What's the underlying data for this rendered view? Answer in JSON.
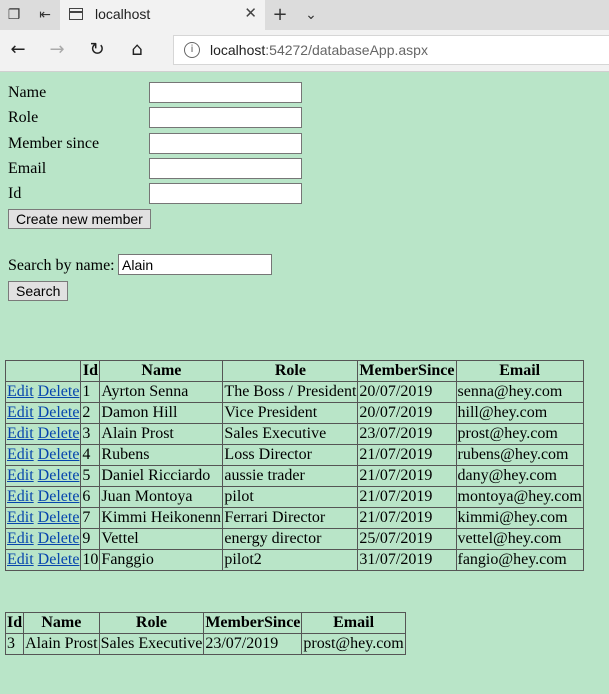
{
  "browser": {
    "tab_title": "localhost",
    "url_host": "localhost",
    "url_rest": ":54272/databaseApp.aspx"
  },
  "form": {
    "name_label": "Name",
    "role_label": "Role",
    "member_since_label": "Member since",
    "email_label": "Email",
    "id_label": "Id",
    "create_button": "Create new member"
  },
  "search": {
    "label": "Search by name:",
    "value": "Alain",
    "button": "Search"
  },
  "members_table": {
    "headers": [
      "",
      "Id",
      "Name",
      "Role",
      "MemberSince",
      "Email"
    ],
    "edit_label": "Edit",
    "delete_label": "Delete",
    "rows": [
      {
        "id": "1",
        "name": "Ayrton Senna",
        "role": "The Boss / President",
        "member_since": "20/07/2019",
        "email": "senna@hey.com"
      },
      {
        "id": "2",
        "name": "Damon Hill",
        "role": "Vice President",
        "member_since": "20/07/2019",
        "email": "hill@hey.com"
      },
      {
        "id": "3",
        "name": "Alain Prost",
        "role": "Sales Executive",
        "member_since": "23/07/2019",
        "email": "prost@hey.com"
      },
      {
        "id": "4",
        "name": "Rubens",
        "role": "Loss Director",
        "member_since": "21/07/2019",
        "email": "rubens@hey.com"
      },
      {
        "id": "5",
        "name": "Daniel Ricciardo",
        "role": "aussie trader",
        "member_since": "21/07/2019",
        "email": "dany@hey.com"
      },
      {
        "id": "6",
        "name": "Juan Montoya",
        "role": "pilot",
        "member_since": "21/07/2019",
        "email": "montoya@hey.com"
      },
      {
        "id": "7",
        "name": "Kimmi Heikonenn",
        "role": "Ferrari Director",
        "member_since": "21/07/2019",
        "email": "kimmi@hey.com"
      },
      {
        "id": "9",
        "name": "Vettel",
        "role": "energy director",
        "member_since": "25/07/2019",
        "email": "vettel@hey.com"
      },
      {
        "id": "10",
        "name": "Fanggio",
        "role": "pilot2",
        "member_since": "31/07/2019",
        "email": "fangio@hey.com"
      }
    ]
  },
  "result_table": {
    "headers": [
      "Id",
      "Name",
      "Role",
      "MemberSince",
      "Email"
    ],
    "rows": [
      {
        "id": "3",
        "name": "Alain Prost",
        "role": "Sales Executive",
        "member_since": "23/07/2019",
        "email": "prost@hey.com"
      }
    ]
  }
}
